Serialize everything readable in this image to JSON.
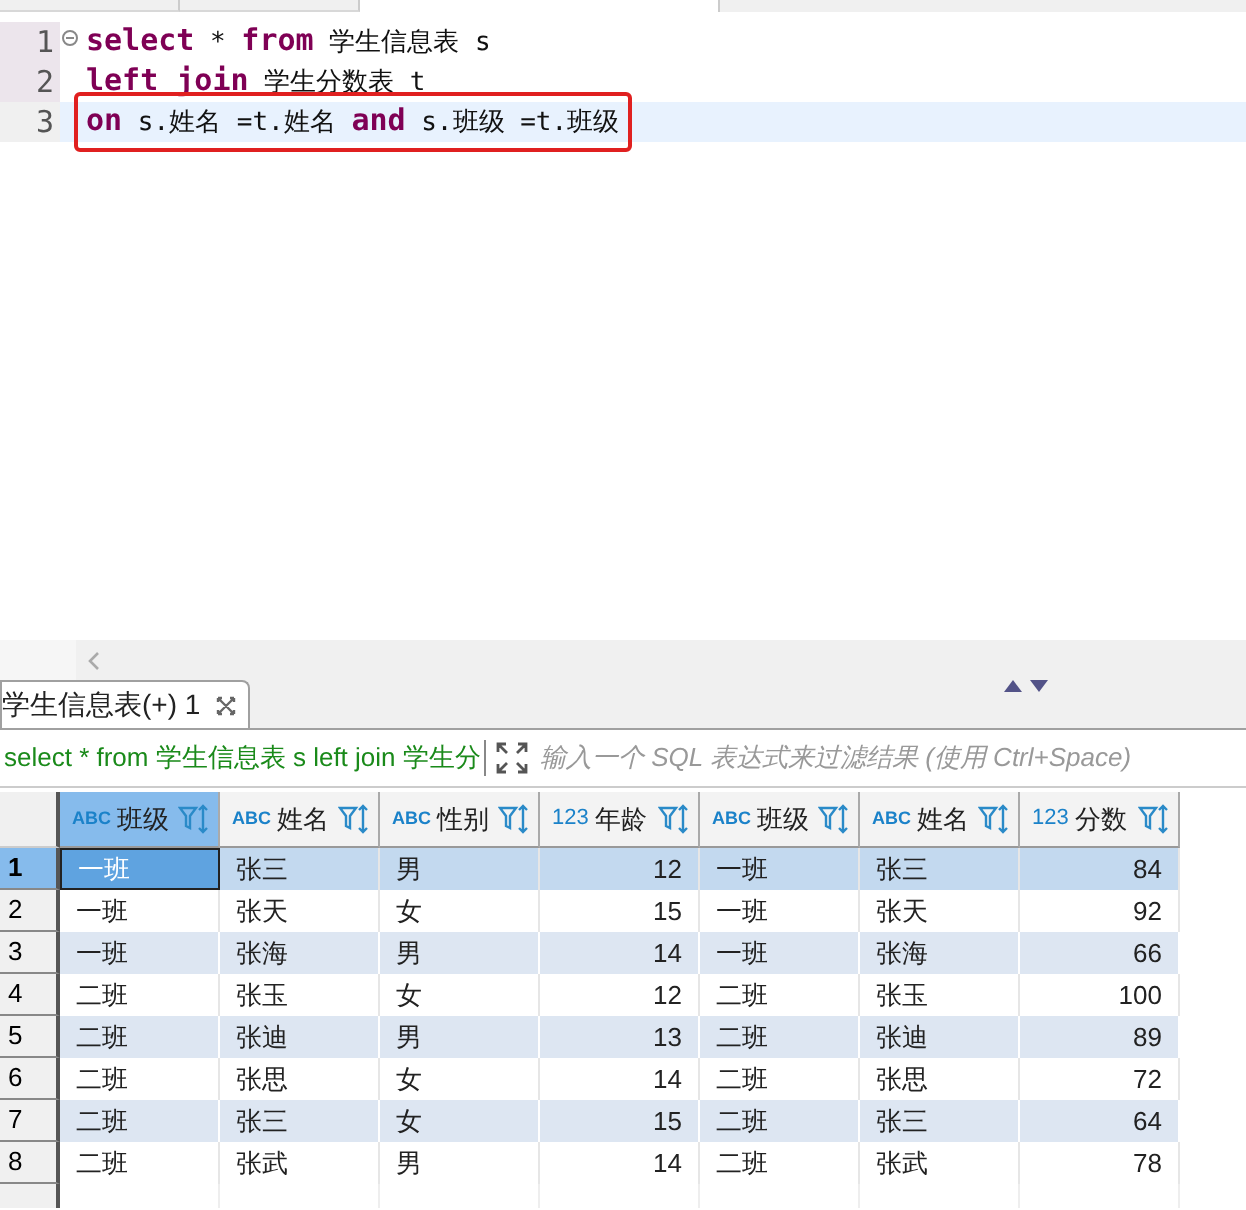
{
  "editor_tabs": [
    {
      "selected": false
    },
    {
      "selected": false
    },
    {
      "selected": true
    }
  ],
  "editor": {
    "lines": [
      {
        "number": "1",
        "current": false,
        "foldable": true,
        "boxed": false,
        "tokens": [
          {
            "kind": "keyword",
            "text": "select"
          },
          {
            "kind": "plain",
            "text": " * "
          },
          {
            "kind": "keyword",
            "text": "from"
          },
          {
            "kind": "plain",
            "text": " 学生信息表 s"
          }
        ]
      },
      {
        "number": "2",
        "current": false,
        "foldable": false,
        "boxed": false,
        "tokens": [
          {
            "kind": "keyword",
            "text": "left join"
          },
          {
            "kind": "plain",
            "text": " 学生分数表 t"
          }
        ]
      },
      {
        "number": "3",
        "current": true,
        "foldable": false,
        "boxed": true,
        "tokens": [
          {
            "kind": "keyword",
            "text": "on"
          },
          {
            "kind": "plain",
            "text": " s.姓名 =t.姓名 "
          },
          {
            "kind": "keyword",
            "text": "and"
          },
          {
            "kind": "plain",
            "text": " s.班级 =t.班级"
          }
        ]
      }
    ]
  },
  "results_tab": {
    "label": "学生信息表(+) 1",
    "selected": true
  },
  "filter_bar": {
    "query": "select * from 学生信息表 s left join 学生分",
    "placeholder": "输入一个 SQL 表达式来过滤结果 (使用 Ctrl+Space)"
  },
  "table": {
    "columns": [
      {
        "type": "ABC",
        "label": "班级"
      },
      {
        "type": "ABC",
        "label": "姓名"
      },
      {
        "type": "ABC",
        "label": "性别"
      },
      {
        "type": "123",
        "label": "年龄"
      },
      {
        "type": "ABC",
        "label": "班级"
      },
      {
        "type": "ABC",
        "label": "姓名"
      },
      {
        "type": "123",
        "label": "分数"
      }
    ],
    "rows": [
      {
        "number": "1",
        "selected": true,
        "cursor_in_first_cell": true,
        "cells": [
          "一班",
          "张三",
          "男",
          "12",
          "一班",
          "张三",
          "84"
        ]
      },
      {
        "number": "2",
        "selected": false,
        "cursor_in_first_cell": false,
        "cells": [
          "一班",
          "张天",
          "女",
          "15",
          "一班",
          "张天",
          "92"
        ]
      },
      {
        "number": "3",
        "selected": false,
        "cursor_in_first_cell": false,
        "cells": [
          "一班",
          "张海",
          "男",
          "14",
          "一班",
          "张海",
          "66"
        ]
      },
      {
        "number": "4",
        "selected": false,
        "cursor_in_first_cell": false,
        "cells": [
          "二班",
          "张玉",
          "女",
          "12",
          "二班",
          "张玉",
          "100"
        ]
      },
      {
        "number": "5",
        "selected": false,
        "cursor_in_first_cell": false,
        "cells": [
          "二班",
          "张迪",
          "男",
          "13",
          "二班",
          "张迪",
          "89"
        ]
      },
      {
        "number": "6",
        "selected": false,
        "cursor_in_first_cell": false,
        "cells": [
          "二班",
          "张思",
          "女",
          "14",
          "二班",
          "张思",
          "72"
        ]
      },
      {
        "number": "7",
        "selected": false,
        "cursor_in_first_cell": false,
        "cells": [
          "二班",
          "张三",
          "女",
          "15",
          "二班",
          "张三",
          "64"
        ]
      },
      {
        "number": "8",
        "selected": false,
        "cursor_in_first_cell": false,
        "cells": [
          "二班",
          "张武",
          "男",
          "14",
          "二班",
          "张武",
          "78"
        ]
      }
    ]
  }
}
